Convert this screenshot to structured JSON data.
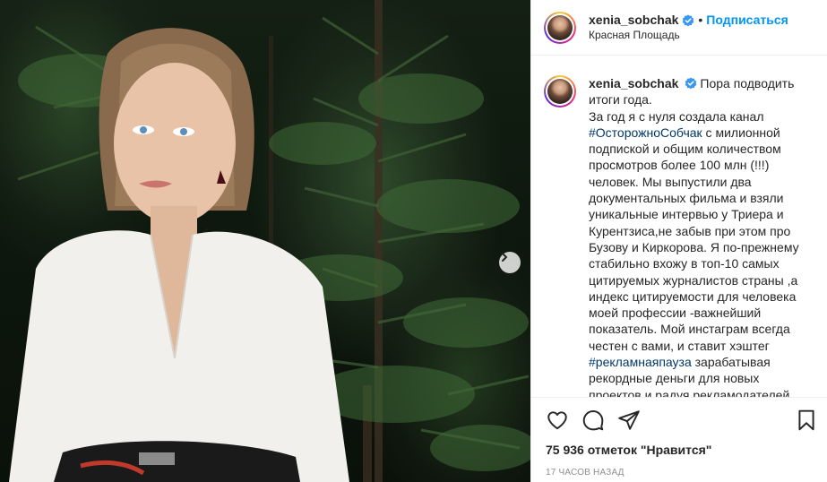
{
  "post": {
    "username": "xenia_sobchak",
    "follow_label": "Подписаться",
    "location": "Красная Площадь",
    "separator": "•"
  },
  "caption": {
    "username": "xenia_sobchak",
    "part1": "Пора подводить итоги года.",
    "part2": "За год я с нуля создала канал ",
    "hashtag1": "#ОсторожноСобчак",
    "part3": " с милионной подпиской и общим количеством просмотров более 100 млн (!!!) человек. Мы выпустили два документальных фильма и взяли уникальные интервью у Триера и Курентзиса,не забыв при этом про Бузову и Киркорова. Я по-прежнему стабильно вхожу в топ-10 самых цитируемых журналистов страны ,а индекс цитируемости для человека моей профессии -важнейший показатель. Мой инстаграм всегда честен с вами, и ставит хэштег ",
    "hashtag2": "#рекламнаяпауза",
    "part4": " зарабатывая рекордные деньги для новых проектов и радуя рекламодателей"
  },
  "stats": {
    "likes": "75 936 отметок \"Нравится\"",
    "time": "17 часов назад"
  },
  "colors": {
    "link": "#0095f6",
    "hashtag": "#00376b",
    "muted": "#8e8e8e",
    "verified": "#3897f0"
  },
  "icons": [
    "verified-badge-icon",
    "heart-icon",
    "comment-icon",
    "share-icon",
    "bookmark-icon",
    "chevron-right-icon"
  ]
}
